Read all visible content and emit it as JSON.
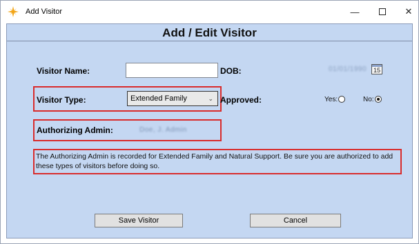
{
  "window": {
    "title": "Add Visitor",
    "minimize_glyph": "—",
    "close_glyph": "✕"
  },
  "header": {
    "title": "Add / Edit Visitor"
  },
  "form": {
    "visitor_name_label": "Visitor Name:",
    "visitor_name_value": "",
    "dob_label": "DOB:",
    "dob_value": "01/01/1990",
    "calendar_day": "15",
    "visitor_type_label": "Visitor Type:",
    "visitor_type_selected": "Extended Family",
    "approved_label": "Approved:",
    "approved_yes_label": "Yes:",
    "approved_no_label": "No:",
    "approved_value": "No",
    "authorizing_admin_label": "Authorizing Admin:",
    "authorizing_admin_value": "Doe, J. Admin",
    "note": "The Authorizing Admin is recorded for Extended Family and Natural Support. Be sure you are authorized to add these types of visitors before doing so."
  },
  "buttons": {
    "save": "Save Visitor",
    "cancel": "Cancel"
  },
  "colors": {
    "highlight": "#d92b2b",
    "panel": "#c4d7f2"
  },
  "icons": {
    "app": "sparkle-icon",
    "calendar": "calendar-icon"
  }
}
